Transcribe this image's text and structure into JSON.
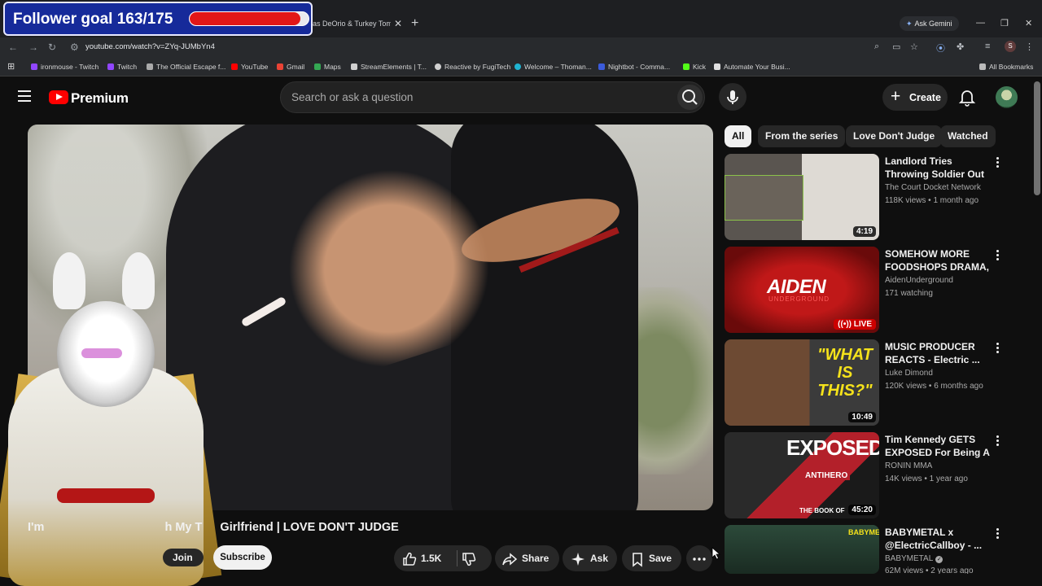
{
  "overlay": {
    "goal_label": "Follower goal 163/175",
    "goal_current": 163,
    "goal_target": 175,
    "goal_fraction": 0.93
  },
  "browser": {
    "tab_title": "as DeOrio & Turkey Tom",
    "url": "youtube.com/watch?v=ZYq-JUMbYn4",
    "gemini_label": "Ask Gemini",
    "profile_initial": "S",
    "bookmarks": [
      {
        "label": "ironmouse - Twitch",
        "color": "#9146ff"
      },
      {
        "label": "Twitch",
        "color": "#9146ff"
      },
      {
        "label": "The Official Escape f...",
        "color": "#aaaaaa"
      },
      {
        "label": "YouTube",
        "color": "#ff0000"
      },
      {
        "label": "Gmail",
        "color": "#ea4335"
      },
      {
        "label": "Maps",
        "color": "#34a853"
      },
      {
        "label": "StreamElements | T...",
        "color": "#d0d0d0"
      },
      {
        "label": "Reactive by FugiTech",
        "color": "#d0d0d0"
      },
      {
        "label": "Welcome – Thoman...",
        "color": "#1fb3d1"
      },
      {
        "label": "Nightbot - Comma...",
        "color": "#3b5bdb"
      },
      {
        "label": "Kick",
        "color": "#53fc18"
      },
      {
        "label": "Automate Your Busi...",
        "color": "#e0e0e0"
      }
    ],
    "all_bookmarks_label": "All Bookmarks"
  },
  "youtube": {
    "brand": "Premium",
    "search_placeholder": "Search or ask a question",
    "create_label": "Create",
    "video_title": "I'm Pregnant With My Trans Girlfriend | LOVE DON'T JUDGE",
    "video_title_visible_prefix": "I'm",
    "video_title_visible_suffix": "h My T",
    "video_title_visible_end": "Girlfriend | LOVE DON'T JUDGE",
    "join_label": "Join",
    "subscribe_label": "Subscribe",
    "likes": "1.5K",
    "share_label": "Share",
    "ask_label": "Ask",
    "save_label": "Save"
  },
  "chips": [
    {
      "label": "All",
      "active": true
    },
    {
      "label": "From the series",
      "active": false
    },
    {
      "label": "Love Don't Judge",
      "active": false
    },
    {
      "label": "Watched",
      "active": false
    }
  ],
  "recommendations": [
    {
      "title": "Landlord Tries Throwing Soldier Out While She's...",
      "channel": "The Court Docket Network",
      "meta": "118K views • 1 month ago",
      "duration": "4:19"
    },
    {
      "title": "SOMEHOW MORE FOODSHOPS DRAMA, ...",
      "channel": "AidenUnderground",
      "meta": "171 watching",
      "live": "LIVE",
      "thumb_text": "AIDEN",
      "thumb_sub": "UNDERGROUND"
    },
    {
      "title": "MUSIC PRODUCER REACTS - Electric ...",
      "channel": "Luke Dimond",
      "meta": "120K views • 6 months ago",
      "duration": "10:49",
      "thumb_text": "\"WHAT IS THIS?\""
    },
    {
      "title": "Tim Kennedy GETS EXPOSED For Being A ...",
      "channel": "RONIN MMA",
      "meta": "14K views • 1 year ago",
      "duration": "45:20",
      "thumb_text": "EXPOSED!?",
      "thumb_sub": "ANTIHERO",
      "thumb_sub2": "THE BOOK OF"
    },
    {
      "title": "BABYMETAL x @ElectricCallboy - ...",
      "channel": "BABYMETAL",
      "meta": "62M views • 2 years ago",
      "thumb_text": "BABYMETAL"
    }
  ]
}
